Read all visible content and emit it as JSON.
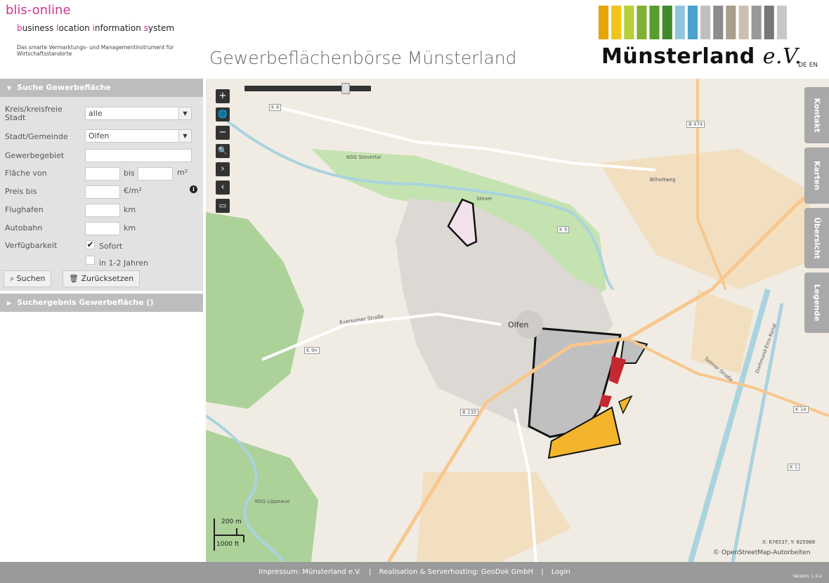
{
  "header": {
    "brand_title": "blis-online",
    "brand_sub_parts": [
      "b",
      "usiness ",
      "l",
      "ocation ",
      "i",
      "nformation ",
      "s",
      "ystem"
    ],
    "brand_desc": "Das smarte Vermarktungs- und Managementinstrument für Wirtschaftsstandorte",
    "page_title": "Gewerbeflächenbörse Münsterland",
    "logo_text": "Münsterland",
    "logo_ev": "e.V.",
    "lang": [
      "DE",
      "EN"
    ],
    "stripe_colors": [
      "#e8a400",
      "#f0c419",
      "#b5cf3a",
      "#7fb135",
      "#5a9d2f",
      "#3f8a2b",
      "#8fc6de",
      "#4aa3cc",
      "#bfbfbf",
      "#8c8c8c",
      "#a89f8c",
      "#c9c1ad",
      "#999999",
      "#777777",
      "#c8c8c8"
    ]
  },
  "sidebar": {
    "search_header": "Suche Gewerbefläche",
    "fields": {
      "kreis_label": "Kreis/kreisfreie Stadt",
      "kreis_value": "alle",
      "stadt_label": "Stadt/Gemeinde",
      "stadt_value": "Olfen",
      "gebiet_label": "Gewerbegebiet",
      "flaeche_label": "Fläche von",
      "flaeche_bis": "bis",
      "flaeche_unit": "m²",
      "preis_label": "Preis bis",
      "preis_unit": "€/m²",
      "flughafen_label": "Flughafen",
      "flughafen_unit": "km",
      "autobahn_label": "Autobahn",
      "autobahn_unit": "km",
      "verfuegbarkeit_label": "Verfügbarkeit",
      "sofort_label": "Sofort",
      "jahre_label": "in 1-2 Jahren"
    },
    "buttons": {
      "search": "Suchen",
      "reset": "Zurücksetzen"
    },
    "result_header": "Suchergebnis Gewerbefläche ()"
  },
  "map": {
    "side_tabs": [
      "Kontakt",
      "Karten",
      "Übersicht",
      "Legende"
    ],
    "controls": [
      "+",
      "🌐",
      "−",
      "🔍",
      "›",
      "‹",
      "▭"
    ],
    "town_label": "Olfen",
    "labels": [
      "NSG Stevertal",
      "Stever",
      "NSG Lippeaue",
      "Eversumer Straße",
      "Selmer Straße",
      "Dortmund-Ems-Kanal",
      "Bilholtweg"
    ],
    "road_shields": [
      "K 8",
      "B 235",
      "K 9",
      "K 9n",
      "B 474",
      "K 14",
      "K 1"
    ],
    "scale_top": "200 m",
    "scale_bottom": "1000 ft",
    "coords": "X: 676537, Y: 825988",
    "attribution": "© OpenStreetMap-Autorbeiten"
  },
  "footer": {
    "links": [
      "Impressum: Münsterland e.V.",
      "|",
      "Realisation & Serverhosting: GeoDok GmbH",
      "|",
      "Login"
    ],
    "version": "Version: 1.0.2"
  }
}
